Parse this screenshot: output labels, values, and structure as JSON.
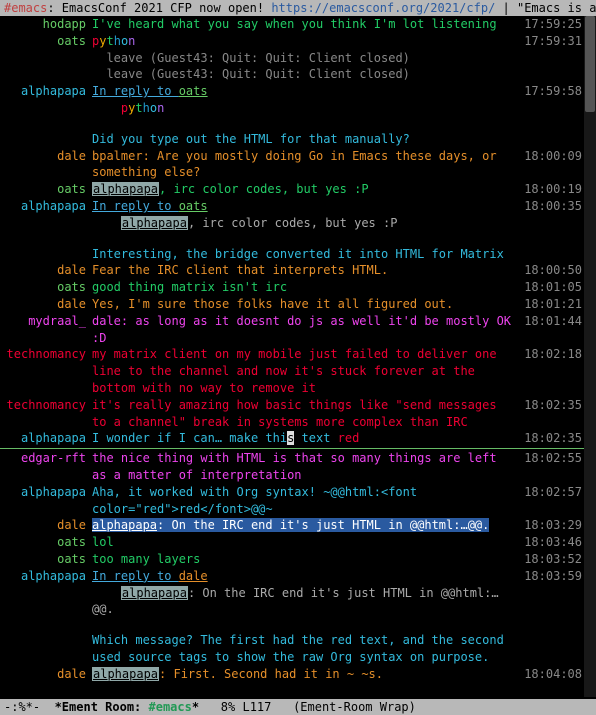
{
  "header": {
    "channel": "#emacs",
    "topic_pre": ": EmacsConf 2021 CFP now open! ",
    "topic_link": "https://emacsconf.org/2021/cfp/",
    "topic_post": " | \"Emacs is a co"
  },
  "modeline": {
    "left": "-:%*-",
    "room_label": "*Ement Room: ",
    "room_name": "#emacs",
    "room_suffix": "*",
    "pos": "8%",
    "line": "L117",
    "mode": "(Ement-Room Wrap)"
  },
  "msgs": [
    {
      "nick": "hodapp",
      "nc": "c-hodapp",
      "body": [
        {
          "t": "I've heard what you say when you think I'm lot listening",
          "c": "t-green"
        }
      ],
      "ts": "17:59:25"
    },
    {
      "nick": "oats",
      "nc": "c-oats",
      "body": [
        {
          "rainbow": "python"
        }
      ],
      "ts": "17:59:31"
    },
    {
      "nick": "",
      "body": [
        {
          "t": "leave (Guest43: Quit: Quit: Client closed)",
          "c": "t-gray",
          "indent": 2
        }
      ],
      "ts": ""
    },
    {
      "nick": "",
      "body": [
        {
          "t": "leave (Guest43: Quit: Quit: Client closed)",
          "c": "t-gray",
          "indent": 2
        }
      ],
      "ts": ""
    },
    {
      "nick": "alphapapa",
      "nc": "c-alphapapa",
      "body": [
        {
          "t": "In reply to ",
          "link": true
        },
        {
          "t": "oats",
          "c": "c-oats",
          "ul": true
        }
      ],
      "ts": "17:59:58"
    },
    {
      "nick": "",
      "body": [
        {
          "rainbow": "python",
          "indent": 4
        }
      ],
      "ts": ""
    },
    {
      "spacer": true
    },
    {
      "nick": "",
      "body": [
        {
          "t": "Did you type out the HTML for that manually?",
          "c": "t-cyan"
        }
      ],
      "ts": ""
    },
    {
      "nick": "dale",
      "nc": "c-dale",
      "body": [
        {
          "t": "bpalmer: Are you mostly doing Go in Emacs these days, or something else?",
          "c": "t-orange"
        }
      ],
      "ts": "18:00:09"
    },
    {
      "nick": "oats",
      "nc": "c-oats",
      "body": [
        {
          "hi": "alphapapa"
        },
        {
          "t": ", irc color codes, but yes :P",
          "c": "t-green"
        }
      ],
      "ts": "18:00:19"
    },
    {
      "nick": "alphapapa",
      "nc": "c-alphapapa",
      "body": [
        {
          "t": "In reply to ",
          "link": true
        },
        {
          "t": "oats",
          "c": "c-oats",
          "ul": true
        }
      ],
      "ts": "18:00:35"
    },
    {
      "nick": "",
      "body": [
        {
          "hi": "alphapapa",
          "indent": 4
        },
        {
          "t": ", irc color codes, but yes :P",
          "c": "t-lgray"
        }
      ],
      "ts": ""
    },
    {
      "spacer": true
    },
    {
      "nick": "",
      "body": [
        {
          "t": "Interesting, the bridge converted it into HTML for Matrix",
          "c": "t-cyan"
        }
      ],
      "ts": ""
    },
    {
      "nick": "dale",
      "nc": "c-dale",
      "body": [
        {
          "t": "Fear the IRC client that interprets HTML.",
          "c": "t-orange"
        }
      ],
      "ts": "18:00:50"
    },
    {
      "nick": "oats",
      "nc": "c-oats",
      "body": [
        {
          "t": "good thing matrix isn't irc",
          "c": "t-green"
        }
      ],
      "ts": "18:01:05"
    },
    {
      "nick": "dale",
      "nc": "c-dale",
      "body": [
        {
          "t": "Yes, I'm sure those folks have it all figured out.",
          "c": "t-orange"
        }
      ],
      "ts": "18:01:21"
    },
    {
      "nick": "mydraal_",
      "nc": "c-mydraal",
      "body": [
        {
          "t": "dale: as long as it doesnt do js as well it'd be mostly OK :D",
          "c": "t-mag"
        }
      ],
      "ts": "18:01:44"
    },
    {
      "nick": "technomancy",
      "nc": "c-technomancy",
      "body": [
        {
          "t": "my matrix client on my mobile just failed to deliver one line to the channel and now it's stuck forever at the bottom with no way to remove it",
          "c": "t-red"
        }
      ],
      "ts": "18:02:18"
    },
    {
      "nick": "technomancy",
      "nc": "c-technomancy",
      "body": [
        {
          "t": "it's really amazing how basic things like \"send messages to a channel\" break in systems more complex than IRC",
          "c": "t-red"
        }
      ],
      "ts": "18:02:35"
    },
    {
      "nick": "alphapapa",
      "nc": "c-alphapapa",
      "body": [
        {
          "t": "I wonder if I can… make thi",
          "c": "t-cyan"
        },
        {
          "cursor": "s"
        },
        {
          "t": " text ",
          "c": "t-cyan"
        },
        {
          "t": "red",
          "c": "t-red"
        }
      ],
      "ts": "18:02:35"
    },
    {
      "rule": true
    },
    {
      "nick": "edgar-rft",
      "nc": "c-edgar",
      "body": [
        {
          "t": "the nice thing with HTML is that so many things are left as a matter of interpretation",
          "c": "t-mag"
        }
      ],
      "ts": "18:02:55"
    },
    {
      "nick": "alphapapa",
      "nc": "c-alphapapa",
      "body": [
        {
          "t": "Aha, it worked with Org syntax!  ~@@html:<font color=\"red\">red</font>@@~",
          "c": "t-cyan"
        }
      ],
      "ts": "18:02:57"
    },
    {
      "nick": "dale",
      "nc": "c-dale",
      "body": [
        {
          "sel_hi": "alphapapa"
        },
        {
          "sel": ": On the IRC end it's just HTML in @@html:…@@."
        }
      ],
      "ts": "18:03:29"
    },
    {
      "nick": "oats",
      "nc": "c-oats",
      "body": [
        {
          "t": "lol",
          "c": "t-green"
        }
      ],
      "ts": "18:03:46"
    },
    {
      "nick": "oats",
      "nc": "c-oats",
      "body": [
        {
          "t": "too many layers",
          "c": "t-green"
        }
      ],
      "ts": "18:03:52"
    },
    {
      "nick": "alphapapa",
      "nc": "c-alphapapa",
      "body": [
        {
          "t": "In reply to ",
          "link": true
        },
        {
          "t": "dale",
          "c": "c-dale",
          "ul": true
        }
      ],
      "ts": "18:03:59"
    },
    {
      "nick": "",
      "body": [
        {
          "hi": "alphapapa",
          "indent": 4
        },
        {
          "t": ": On the IRC end it's just HTML in @@html:…@@.",
          "c": "t-lgray"
        }
      ],
      "ts": ""
    },
    {
      "spacer": true
    },
    {
      "nick": "",
      "body": [
        {
          "t": "Which message? The first had the red text, and the second used source tags to show the raw Org syntax on purpose.",
          "c": "t-cyan"
        }
      ],
      "ts": ""
    },
    {
      "nick": "dale",
      "nc": "c-dale",
      "body": [
        {
          "hi": "alphapapa"
        },
        {
          "t": ": First. Second had it in ~ ~s.",
          "c": "t-orange"
        }
      ],
      "ts": "18:04:08"
    }
  ]
}
